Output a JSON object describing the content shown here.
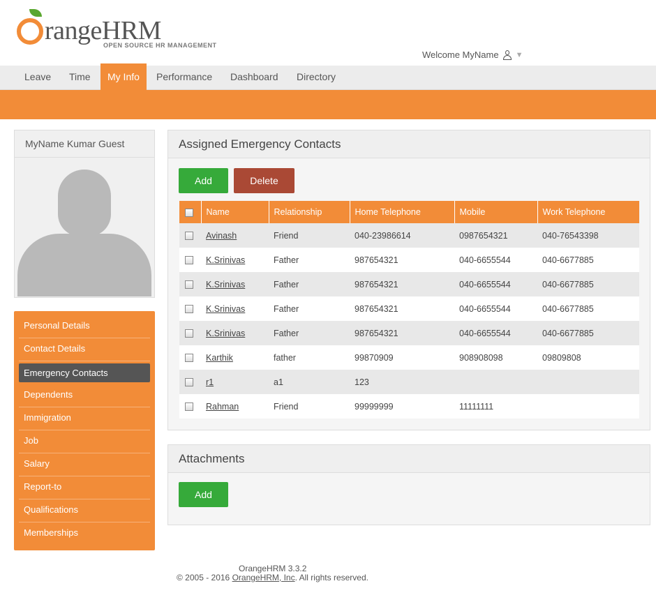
{
  "brand": {
    "word": "rangeHRM",
    "hrm": "HRM",
    "tagline": "OPEN SOURCE HR MANAGEMENT"
  },
  "header": {
    "welcome": "Welcome MyName"
  },
  "nav": [
    "Leave",
    "Time",
    "My Info",
    "Performance",
    "Dashboard",
    "Directory"
  ],
  "profile": {
    "name": "MyName Kumar Guest"
  },
  "sidemenu": [
    "Personal Details",
    "Contact Details",
    "Emergency Contacts",
    "Dependents",
    "Immigration",
    "Job",
    "Salary",
    "Report-to",
    "Qualifications",
    "Memberships"
  ],
  "emergency": {
    "title": "Assigned Emergency Contacts",
    "add_label": "Add",
    "delete_label": "Delete",
    "columns": [
      "Name",
      "Relationship",
      "Home Telephone",
      "Mobile",
      "Work Telephone"
    ],
    "rows": [
      [
        "Avinash",
        "Friend",
        "040-23986614",
        "0987654321",
        "040-76543398"
      ],
      [
        "K.Srinivas",
        "Father",
        "987654321",
        "040-6655544",
        "040-6677885"
      ],
      [
        "K.Srinivas",
        "Father",
        "987654321",
        "040-6655544",
        "040-6677885"
      ],
      [
        "K.Srinivas",
        "Father",
        "987654321",
        "040-6655544",
        "040-6677885"
      ],
      [
        "K.Srinivas",
        "Father",
        "987654321",
        "040-6655544",
        "040-6677885"
      ],
      [
        "Karthik",
        "father",
        "99870909",
        "908908098",
        "09809808"
      ],
      [
        "r1",
        "a1",
        "123",
        "",
        ""
      ],
      [
        "Rahman",
        "Friend",
        "99999999",
        "11111111",
        ""
      ]
    ]
  },
  "attachments": {
    "title": "Attachments",
    "add_label": "Add"
  },
  "footer": {
    "version": "OrangeHRM 3.3.2",
    "copy_prefix": "© 2005 - 2016 ",
    "company": "OrangeHRM, Inc",
    "copy_suffix": ". All rights reserved."
  },
  "colors": {
    "accent": "#f28c38",
    "add": "#36aa3a",
    "delete": "#aa4935",
    "active_menu": "#555555"
  }
}
